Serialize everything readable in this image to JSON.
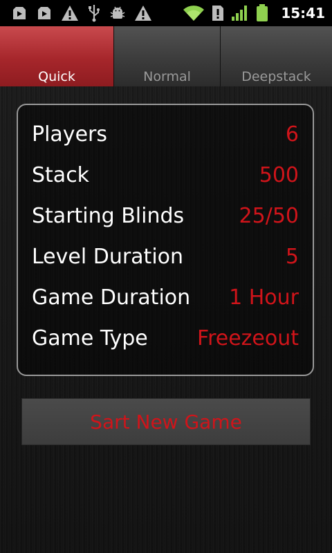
{
  "status_bar": {
    "time": "15:41",
    "icons": [
      "play-store-icon",
      "play-store-icon",
      "warning-icon",
      "usb-icon",
      "android-debug-icon",
      "warning-icon",
      "wifi-icon",
      "sim-alert-icon",
      "signal-icon",
      "battery-icon"
    ]
  },
  "tabs": [
    {
      "label": "Quick",
      "active": true
    },
    {
      "label": "Normal",
      "active": false
    },
    {
      "label": "Deepstack",
      "active": false
    }
  ],
  "settings": [
    {
      "label": "Players",
      "value": "6"
    },
    {
      "label": "Stack",
      "value": "500"
    },
    {
      "label": "Starting Blinds",
      "value": "25/50"
    },
    {
      "label": "Level Duration",
      "value": "5"
    },
    {
      "label": "Game Duration",
      "value": "1 Hour"
    },
    {
      "label": "Game Type",
      "value": "Freezeout"
    }
  ],
  "start_button": {
    "label": "Sart New Game"
  },
  "colors": {
    "accent": "#d0141a",
    "active_tab": "#b2343a",
    "text": "#ffffff"
  }
}
